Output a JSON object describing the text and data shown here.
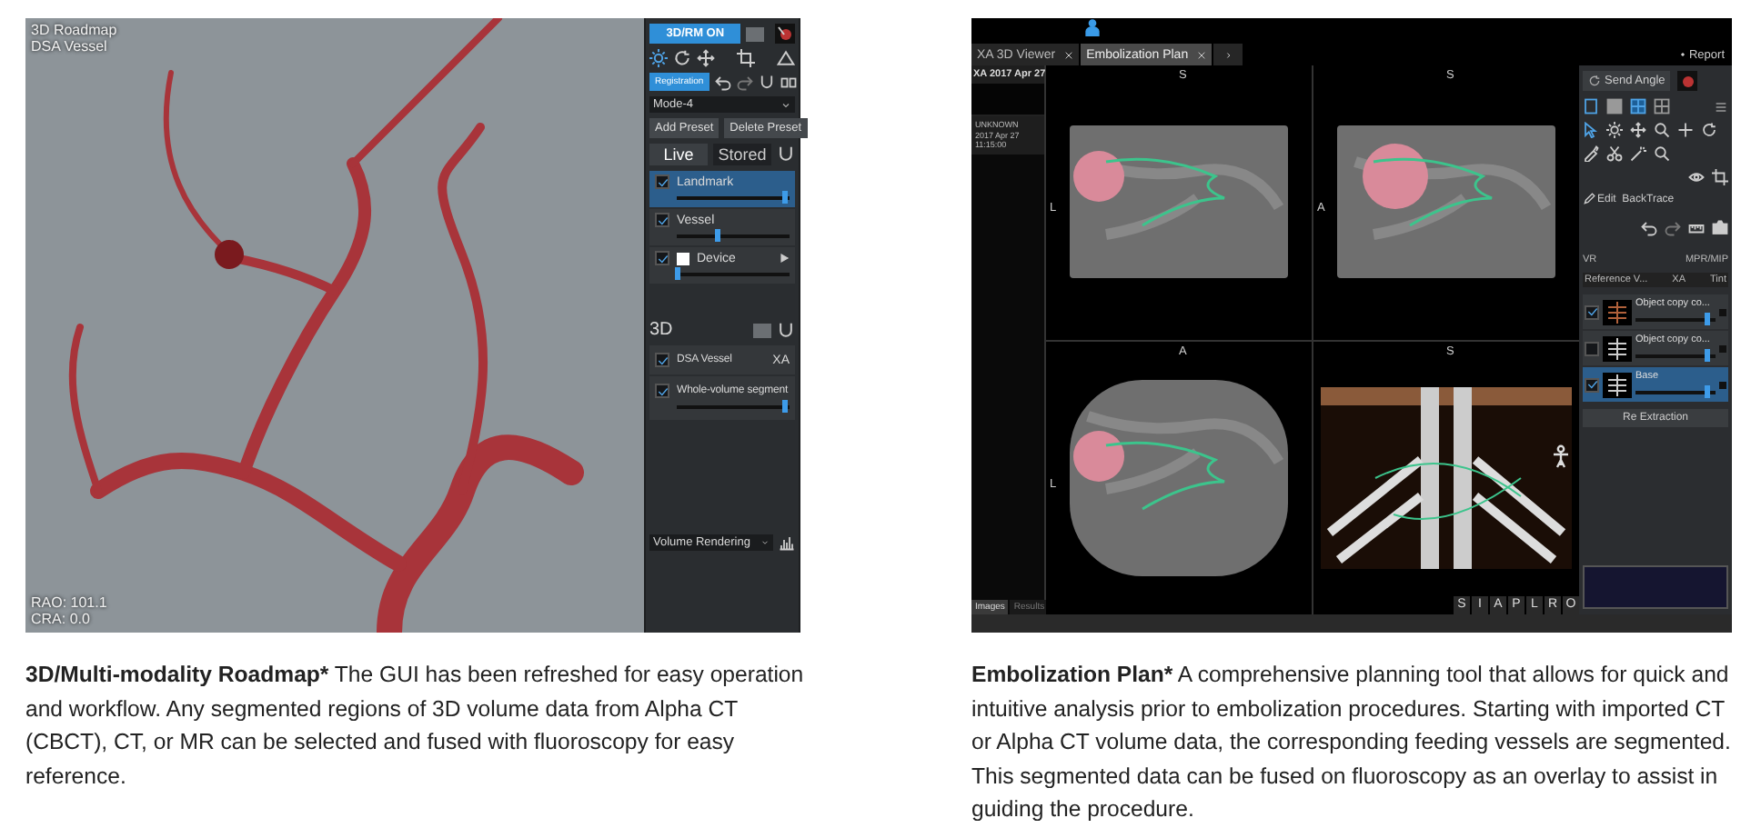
{
  "roadmap_screen": {
    "overlay_top": [
      "3D Roadmap",
      "DSA Vessel"
    ],
    "overlay_bottom": [
      "RAO: 101.1",
      "CRA: 0.0"
    ],
    "toggle_button": "3D/RM ON",
    "registration_button": "Registration",
    "mode": "Mode-4",
    "preset_buttons": [
      "Add Preset",
      "Delete Preset"
    ],
    "tabs": [
      {
        "label": "Live",
        "selected": true
      },
      {
        "label": "Stored",
        "selected": false
      }
    ],
    "live_items": [
      {
        "label": "Landmark",
        "kind": "plain",
        "checked": true,
        "selected": true,
        "level": 0.97
      },
      {
        "label": "Vessel",
        "kind": "plain",
        "checked": true,
        "selected": false,
        "level": 0.37
      },
      {
        "label": "Device",
        "kind": "swatch",
        "checked": true,
        "selected": false,
        "level": 0.02
      }
    ],
    "section_3d": "3D",
    "items_3d": [
      {
        "label": "DSA Vessel",
        "tag": "XA",
        "checked": true
      },
      {
        "label": "Whole-volume segment",
        "checked": true,
        "level": 0.97
      }
    ],
    "render_mode": "Volume Rendering"
  },
  "embolization_screen": {
    "tabs": [
      {
        "label": "XA 3D Viewer",
        "selected": false
      },
      {
        "label": "Embolization Plan",
        "selected": true
      }
    ],
    "report": "Report",
    "series_label": "XA 2017 Apr 27",
    "patient_info": [
      "UNKNOWN",
      "2017 Apr 27",
      "11:15:00"
    ],
    "viewports": [
      {
        "top": "S",
        "side": "L",
        "kind": "ct"
      },
      {
        "top": "S",
        "side": "A",
        "kind": "ct"
      },
      {
        "top": "A",
        "side": "L",
        "kind": "ct"
      },
      {
        "top": "S",
        "kind": "vr"
      }
    ],
    "orientation_buttons": [
      "S",
      "I",
      "A",
      "P",
      "L",
      "R",
      "O"
    ],
    "bottom_tabs": [
      {
        "label": "Images",
        "selected": true
      },
      {
        "label": "Results",
        "selected": false
      }
    ],
    "send_angle": "Send Angle",
    "backtrace": "Edit  BackTrace",
    "vr_label": "VR",
    "mpr_label": "MPR/MIP",
    "table_header": [
      "Reference V...",
      "XA",
      "Tint"
    ],
    "objects": [
      {
        "label": "Object copy co...",
        "checked": true,
        "selected": false,
        "level": 0.92
      },
      {
        "label": "Object copy co...",
        "checked": false,
        "selected": false,
        "level": 0.92
      },
      {
        "label": "Base",
        "checked": true,
        "selected": true,
        "level": 0.92
      }
    ],
    "extraction_button": "Re Extraction"
  },
  "captions": [
    {
      "title": "3D/Multi-modality Roadmap*",
      "body": "The GUI has been refreshed for easy operation and workflow. Any segmented regions of 3D volume data from Alpha CT (CBCT), CT, or MR can be selected and fused with fluoroscopy for easy reference."
    },
    {
      "title": "Embolization Plan*",
      "body": "A comprehensive planning tool that allows for quick and intuitive analysis prior to embolization procedures. Starting with imported CT or Alpha CT volume data, the corresponding feeding vessels are segmented. This segmented data can be fused on fluoroscopy as an overlay to assist in guiding the procedure."
    }
  ]
}
